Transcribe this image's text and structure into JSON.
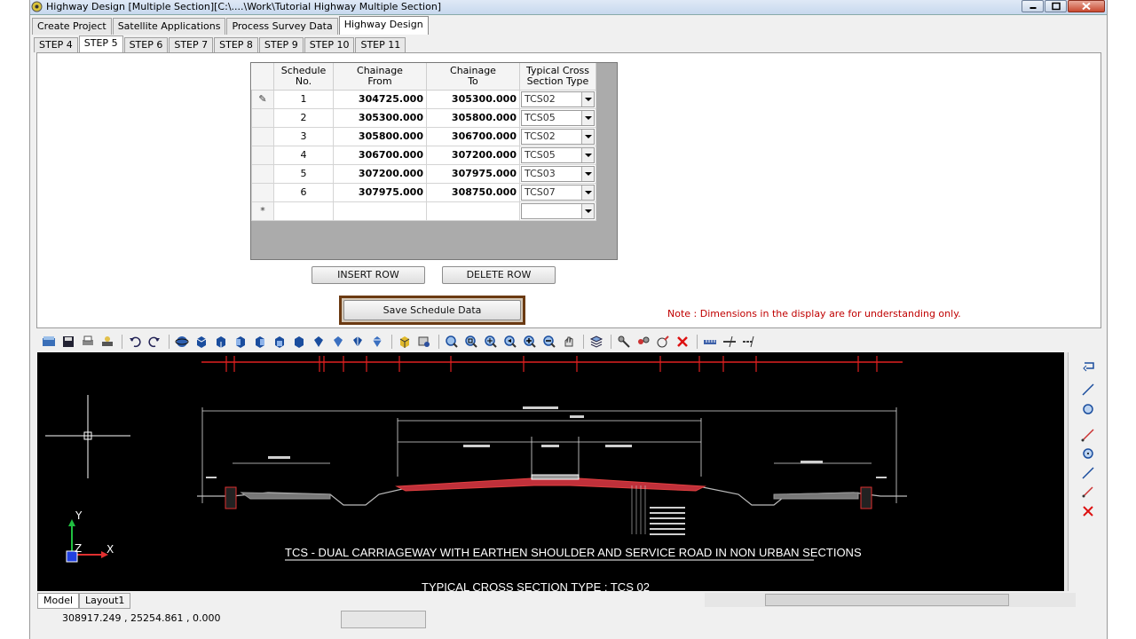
{
  "window": {
    "title": "Highway Design [Multiple Section][C:\\....\\Work\\Tutorial Highway Multiple Section]"
  },
  "top_tabs": [
    "Create Project",
    "Satellite Applications",
    "Process Survey Data",
    "Highway Design"
  ],
  "step_tabs": [
    "STEP 4",
    "STEP 5",
    "STEP 6",
    "STEP 7",
    "STEP 8",
    "STEP 9",
    "STEP 10",
    "STEP 11"
  ],
  "grid": {
    "headers": [
      "Schedule No.",
      "Chainage From",
      "Chainage To",
      "Typical Cross Section Type"
    ],
    "header_lines": [
      [
        "Schedule",
        "No."
      ],
      [
        "Chainage",
        "From"
      ],
      [
        "Chainage",
        "To"
      ],
      [
        "Typical Cross",
        "Section Type"
      ]
    ],
    "rows": [
      {
        "no": "1",
        "from": "304725.000",
        "to": "305300.000",
        "type": "TCS02"
      },
      {
        "no": "2",
        "from": "305300.000",
        "to": "305800.000",
        "type": "TCS05"
      },
      {
        "no": "3",
        "from": "305800.000",
        "to": "306700.000",
        "type": "TCS02"
      },
      {
        "no": "4",
        "from": "306700.000",
        "to": "307200.000",
        "type": "TCS05"
      },
      {
        "no": "5",
        "from": "307200.000",
        "to": "307975.000",
        "type": "TCS03"
      },
      {
        "no": "6",
        "from": "307975.000",
        "to": "308750.000",
        "type": "TCS07"
      }
    ],
    "new_row_marker": "*",
    "edit_marker": "✎"
  },
  "buttons": {
    "insert_row": "INSERT ROW",
    "delete_row": "DELETE ROW",
    "save": "Save Schedule Data"
  },
  "note": "Note : Dimensions in the display are for understanding only.",
  "drawing": {
    "caption": "TCS - DUAL CARRIAGEWAY WITH EARTHEN SHOULDER AND SERVICE ROAD IN NON URBAN  SECTIONS",
    "title": "TYPICAL CROSS SECTION TYPE  : TCS 02",
    "axis_y": "Y",
    "axis_z": "Z",
    "axis_x": "X"
  },
  "bottom_tabs": [
    "Model",
    "Layout1"
  ],
  "status": {
    "coordinates": "308917.249 , 25254.861 , 0.000"
  }
}
